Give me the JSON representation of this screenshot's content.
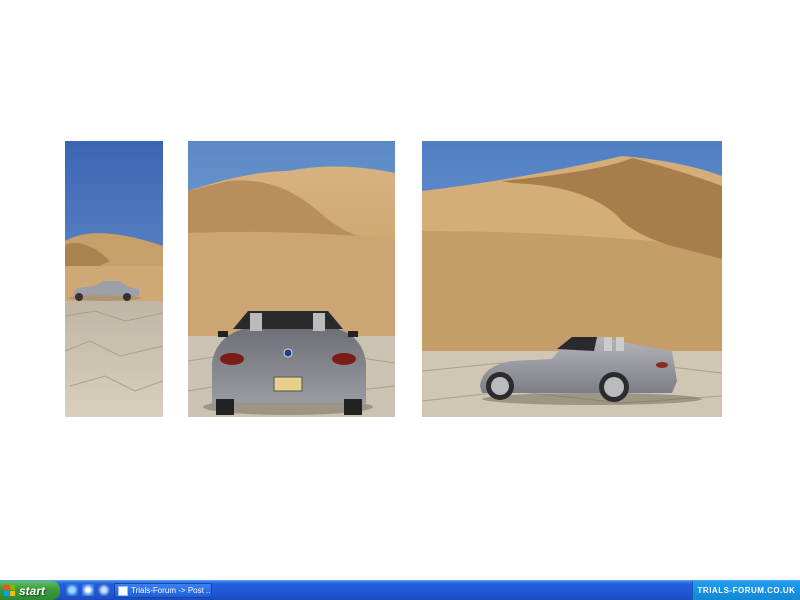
{
  "taskbar": {
    "start_label": "start",
    "quick_launch": [
      "internet-explorer-icon",
      "outlook-express-icon",
      "windows-media-icon"
    ],
    "task_button_label": "Trials-Forum -> Post ...",
    "tray_text": "TRIALS-FORUM.CO.UK"
  },
  "colors": {
    "taskbar_blue": "#245edc",
    "start_green": "#3c9a3c",
    "sky": "#6e9ad3",
    "sand": "#d3ad7a",
    "car_silver": "#8f8f95"
  }
}
